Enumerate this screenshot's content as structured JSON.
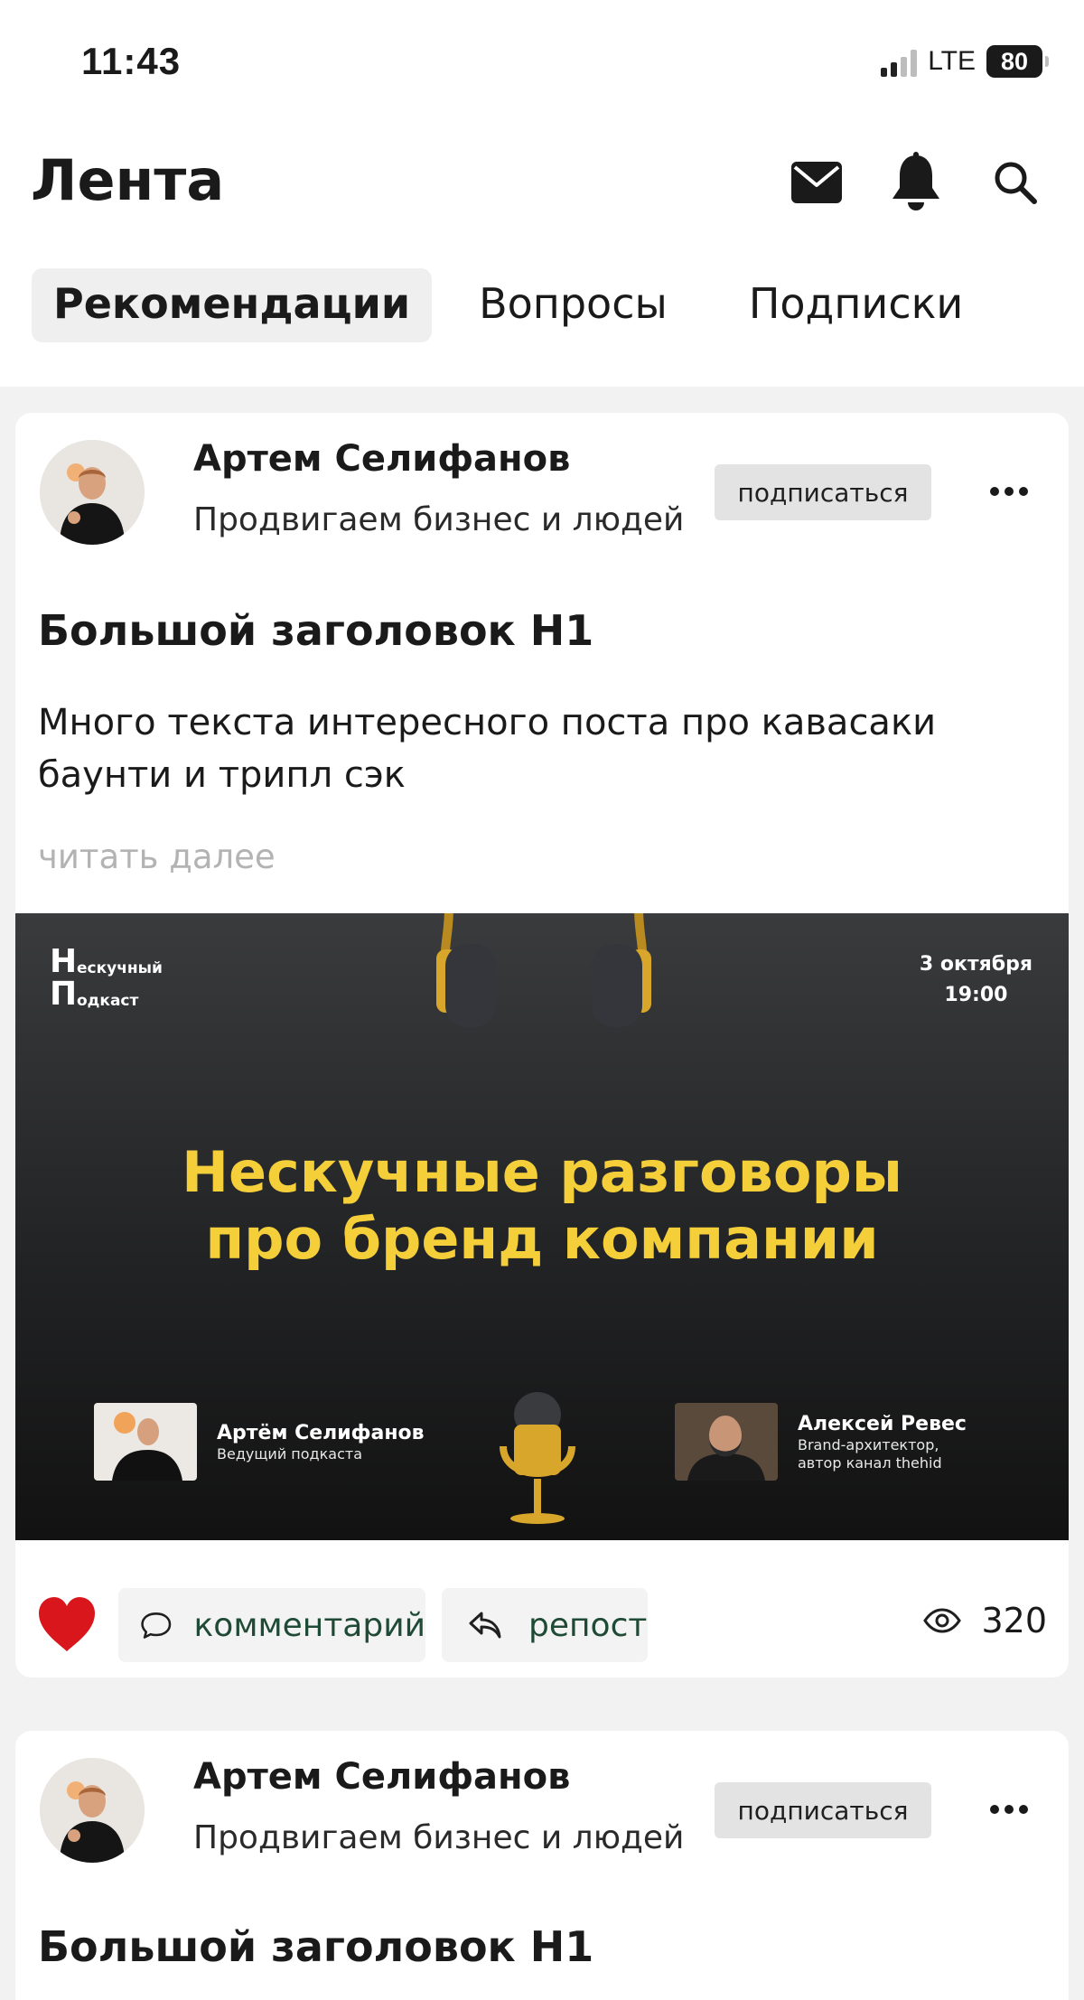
{
  "status_bar": {
    "time": "11:43",
    "network": "LTE",
    "battery": "80"
  },
  "header": {
    "title": "Лента",
    "icons": [
      "mail-icon",
      "bell-icon",
      "search-icon"
    ]
  },
  "tabs": [
    {
      "label": "Рекомендации",
      "active": true
    },
    {
      "label": "Вопросы",
      "active": false
    },
    {
      "label": "Подписки",
      "active": false
    }
  ],
  "posts": [
    {
      "author": {
        "name": "Артем Селифанов",
        "subtitle": "Продвигаем бизнес и людей"
      },
      "subscribe_label": "подписаться",
      "title": "Большой заголовок Н1",
      "body": "Много текста интересного поста про кавасаки баунти и трипл сэк",
      "read_more": "читать далее",
      "banner": {
        "brand_line1_letter": "Н",
        "brand_line1_rest": "ескучный",
        "brand_line2_letter": "П",
        "brand_line2_rest": "одкаст",
        "date": "3 октября",
        "time": "19:00",
        "headline_line1": "Нескучные разговоры",
        "headline_line2": "про бренд компании",
        "hosts": [
          {
            "name": "Артём Селифанов",
            "role_line1": "Ведущий подкаста",
            "role_line2": ""
          },
          {
            "name": "Алексей Ревес",
            "role_line1": "Brand-архитектор,",
            "role_line2": "автор канал thehid"
          }
        ],
        "accent_color": "#f5cf3a"
      },
      "actions": {
        "comment_label": "комментарий",
        "repost_label": "репост",
        "views": "320",
        "liked": true
      }
    },
    {
      "author": {
        "name": "Артем Селифанов",
        "subtitle": "Продвигаем бизнес и людей"
      },
      "subscribe_label": "подписаться",
      "title": "Большой заголовок Н1"
    }
  ]
}
